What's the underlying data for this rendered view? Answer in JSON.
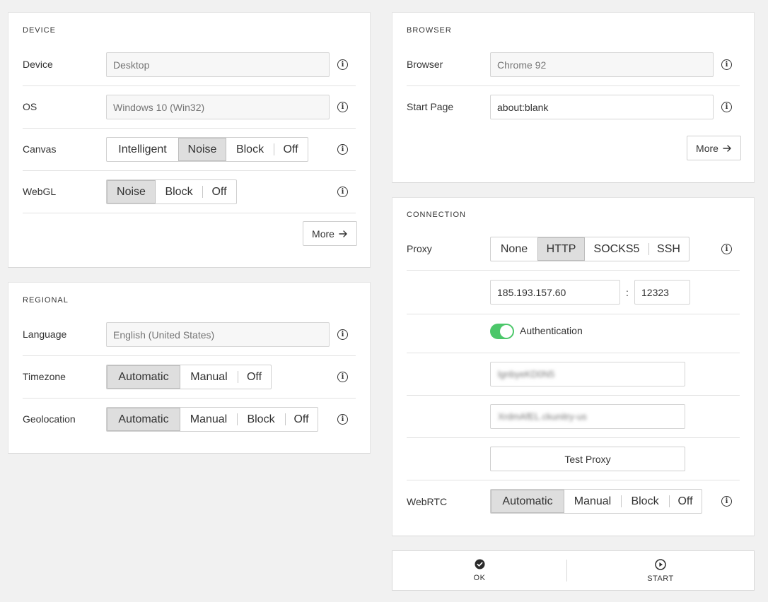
{
  "device": {
    "title": "DEVICE",
    "device_label": "Device",
    "device_placeholder": "Desktop",
    "os_label": "OS",
    "os_placeholder": "Windows 10 (Win32)",
    "canvas_label": "Canvas",
    "canvas_options": [
      "Intelligent",
      "Noise",
      "Block",
      "Off"
    ],
    "canvas_selected": "Noise",
    "webgl_label": "WebGL",
    "webgl_options": [
      "Noise",
      "Block",
      "Off"
    ],
    "webgl_selected": "Noise",
    "more_label": "More"
  },
  "regional": {
    "title": "REGIONAL",
    "language_label": "Language",
    "language_placeholder": "English (United States)",
    "timezone_label": "Timezone",
    "timezone_options": [
      "Automatic",
      "Manual",
      "Off"
    ],
    "timezone_selected": "Automatic",
    "geolocation_label": "Geolocation",
    "geolocation_options": [
      "Automatic",
      "Manual",
      "Block",
      "Off"
    ],
    "geolocation_selected": "Automatic"
  },
  "browser": {
    "title": "BROWSER",
    "browser_label": "Browser",
    "browser_placeholder": "Chrome 92",
    "start_page_label": "Start Page",
    "start_page_value": "about:blank",
    "more_label": "More"
  },
  "connection": {
    "title": "CONNECTION",
    "proxy_label": "Proxy",
    "proxy_options": [
      "None",
      "HTTP",
      "SOCKS5",
      "SSH"
    ],
    "proxy_selected": "HTTP",
    "host_value": "185.193.157.60",
    "port_separator": ":",
    "port_value": "12323",
    "auth_label": "Authentication",
    "auth_enabled": true,
    "username_value": "lgnbyeKD0N5",
    "password_value": "XrdmAfEL.ckunitry-us",
    "test_proxy_label": "Test Proxy",
    "webrtc_label": "WebRTC",
    "webrtc_options": [
      "Automatic",
      "Manual",
      "Block",
      "Off"
    ],
    "webrtc_selected": "Automatic"
  },
  "actions": {
    "ok_label": "OK",
    "start_label": "START"
  },
  "icons": {
    "info": "info-icon",
    "arrow": "arrow-right-icon",
    "ok": "check-circle-icon",
    "start": "play-circle-icon"
  },
  "colors": {
    "toggle_on": "#4cc76a",
    "segment_active": "#dedede"
  }
}
